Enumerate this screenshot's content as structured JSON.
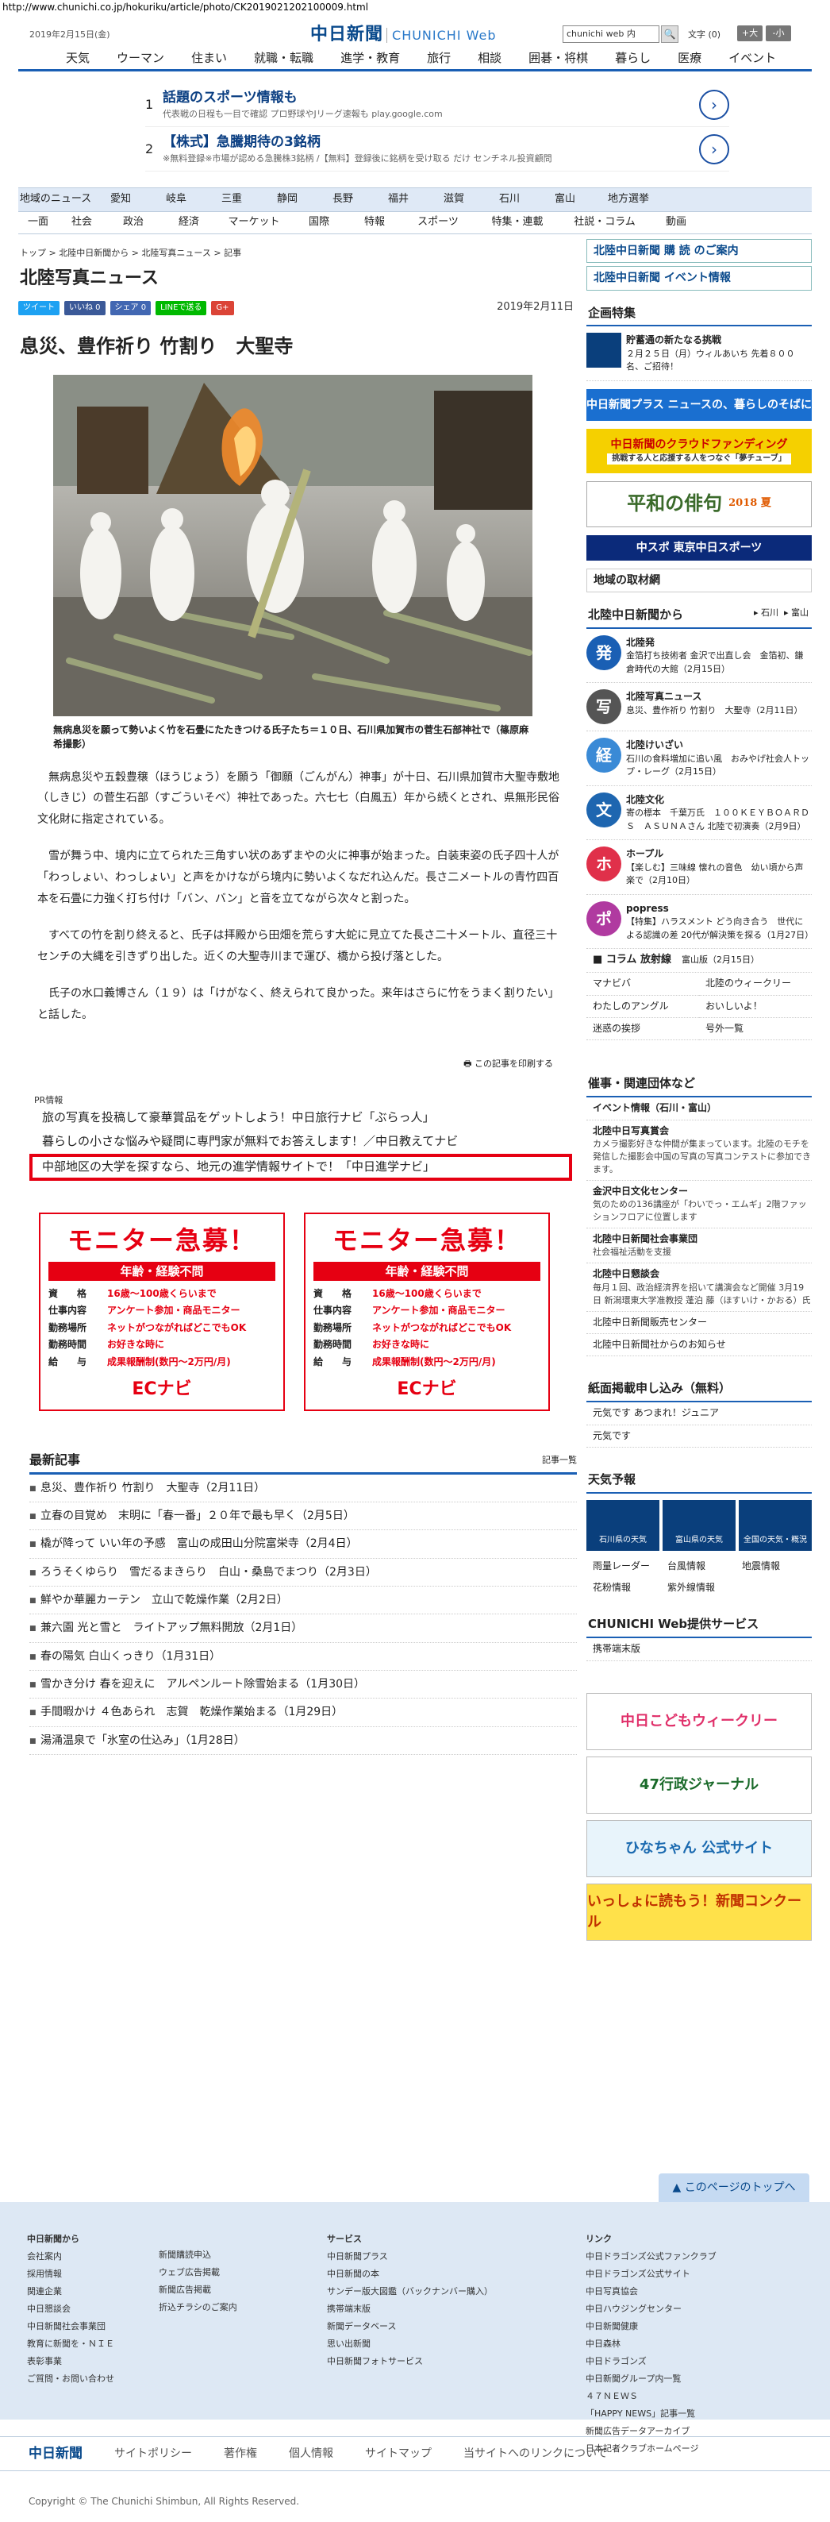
{
  "url": "http://www.chunichi.co.jp/hokuriku/article/photo/CK2019021202100009.html",
  "header": {
    "date": "2019年2月15日(金)",
    "logo": "中日新聞",
    "logo_web": "CHUNICHI Web",
    "search_value": "chunichi web 内",
    "font_size_label": "文字",
    "font_zero": "(0)",
    "font_plus": "+大",
    "font_minus": "-小"
  },
  "global_nav": [
    "天気",
    "ウーマン",
    "住まい",
    "就職・転職",
    "進学・教育",
    "旅行",
    "相談",
    "囲碁・将棋",
    "暮らし",
    "医療",
    "イベント"
  ],
  "ads": [
    {
      "num": "1",
      "title": "話題のスポーツ情報も",
      "sub": "代表戦の日程も一目で確認 プロ野球やJリーグ速報も play.google.com"
    },
    {
      "num": "2",
      "title": "【株式】急騰期待の3銘柄",
      "sub": "※無料登録※市場が認める急騰株3銘柄 /【無料】登録後に銘柄を受け取る だけ センチネル投資顧問"
    }
  ],
  "category_nav": {
    "row1": [
      "地域のニュース",
      "愛知",
      "岐阜",
      "三重",
      "静岡",
      "長野",
      "福井",
      "滋賀",
      "石川",
      "富山",
      "地方選挙"
    ],
    "row2": [
      "一面",
      "社会",
      "政治",
      "経済",
      "マーケット",
      "国際",
      "特報",
      "スポーツ",
      "特集・連載",
      "社説・コラム",
      "動画"
    ]
  },
  "breadcrumb": "トップ > 北陸中日新聞から > 北陸写真ニュース > 記事",
  "section_title": "北陸写真ニュース",
  "social": {
    "tweet": "ツイート",
    "like": "いいね 0",
    "share": "シェア 0",
    "line": "LINEで送る",
    "gplus": "G+"
  },
  "article": {
    "date": "2019年2月11日",
    "headline": "息災、豊作祈り 竹割り　大聖寺",
    "caption": "無病息災を願って勢いよく竹を石畳にたたきつける氏子たち＝１０日、石川県加賀市の菅生石部神社で（篠原麻希撮影）",
    "paragraphs": [
      "無病息災や五穀豊穣（ほうじょう）を願う「御願（ごんがん）神事」が十日、石川県加賀市大聖寺敷地（しきじ）の菅生石部（すごういそべ）神社であった。六七七（白鳳五）年から続くとされ、県無形民俗文化財に指定されている。",
      "雪が舞う中、境内に立てられた三角すい状のあずまやの火に神事が始まった。白装束姿の氏子四十人が「わっしょい、わっしょい」と声をかけながら境内に勢いよくなだれ込んだ。長さ二メートルの青竹四百本を石畳に力強く打ち付け「バン、バン」と音を立てながら次々と割った。",
      "すべての竹を割り終えると、氏子は拝殿から田畑を荒らす大蛇に見立てた長さ二十メートル、直径三十センチの大縄を引きずり出した。近くの大聖寺川まで運び、橋から投げ落とした。",
      "氏子の水口義博さん（１９）は「けがなく、終えられて良かった。来年はさらに竹をうまく割りたい」と話した。"
    ],
    "print_label": "この記事を印刷する"
  },
  "pr": {
    "label": "PR情報",
    "items": [
      "旅の写真を投稿して豪華賞品をゲットしよう！中日旅行ナビ「ぶらっ人」",
      "暮らしの小さな悩みや疑問に専門家が無料でお答えします！／中日教えてナビ",
      "中部地区の大学を探すなら、地元の進学情報サイトで！「中日進学ナビ」"
    ]
  },
  "banner": {
    "title": "モニター急募！",
    "sub": "年齢・経験不問",
    "rows": [
      {
        "k": "資　　格",
        "v": "16歳〜100歳くらいまで"
      },
      {
        "k": "仕事内容",
        "v": "アンケート参加・商品モニター"
      },
      {
        "k": "勤務場所",
        "v": "ネットがつながればどこでもOK"
      },
      {
        "k": "勤務時間",
        "v": "お好きな時に"
      },
      {
        "k": "給　　与",
        "v": "成果報酬制(数円〜2万円/月)"
      }
    ],
    "brand": "ECナビ"
  },
  "latest": {
    "title": "最新記事",
    "all_label": "記事一覧",
    "items": [
      "息災、豊作祈り 竹割り　大聖寺（2月11日）",
      "立春の目覚め　末明に「春一番」２０年で最も早く（2月5日）",
      "橇が降って いい年の予感　富山の成田山分院富栄寺（2月4日）",
      "ろうそくゆらり　雪だるまきらり　白山・桑島でまつり（2月3日）",
      "鮮やか華麗カーテン　立山で乾燥作業（2月2日）",
      "兼六園 光と雪と　ライトアップ無料開放（2月1日）",
      "春の陽気 白山くっきり（1月31日）",
      "雪かき分け 春を迎えに　アルペンルート除雪始まる（1月30日）",
      "手間暇かけ ４色あられ　志賀　乾燥作業始まる（1月29日）",
      "湯涌温泉で「氷室の仕込み」（1月28日）"
    ]
  },
  "side": {
    "subscribe": "北陸中日新聞 購 読 のご案内",
    "event": "北陸中日新聞 イベント情報",
    "feature_title": "企画特集",
    "feature_item": "貯蓄通の新たなる挑戦",
    "feature_sub": "２月２５日（月）ウィルあいち 先着８００名、ご招待！",
    "blue_banner": "中日新聞プラス ニュースの、暮らしのそばに",
    "crowdfunding": "中日新聞のクラウドファンディング",
    "crowd_sub": "挑戦する人と応援する人をつなぐ「夢チューブ」",
    "haiku": "平和の俳句",
    "haiku_year": "2018 夏",
    "sports": "中スポ 東京中日スポーツ",
    "local_label": "地域の取材網",
    "hokuriku_title": "北陸中日新聞から",
    "hokuriku_links": [
      "石川",
      "富山"
    ],
    "items": [
      {
        "icon": "発",
        "color": "#1a5fb4",
        "title": "北陸発",
        "text": "金箔打ち技術者 金沢で出直し会　金箔初、鎌倉時代の大館（2月15日）"
      },
      {
        "icon": "写",
        "color": "#555",
        "title": "北陸写真ニュース",
        "text": "息災、豊作祈り 竹割り　大聖寺（2月11日）"
      },
      {
        "icon": "経",
        "color": "#3a8ad6",
        "title": "北陸けいざい",
        "text": "石川の食料増加に追い風　おみやげ社会人トップ・レーグ（2月15日）"
      },
      {
        "icon": "文",
        "color": "#1e66b0",
        "title": "北陸文化",
        "text": "寄の標本　千葉万氏　１００ＫＥＹＢＯＡＲＤＳ　ＡＳＵＮＡさん 北陸で初演奏（2月9日）"
      },
      {
        "icon": "ホ",
        "color": "#e0304a",
        "title": "ホープル",
        "text": "【楽しむ】三味線 懐れの音色　幼い頃から声楽で（2月10日）"
      },
      {
        "icon": "ポ",
        "color": "#b03aa0",
        "title": "popress",
        "text": "【特集】ハラスメント どう向き合う　世代による認識の差 20代が解決策を探る（1月27日）"
      }
    ],
    "column_title": "コラム 放射線",
    "column_date": "富山版（2月15日）",
    "grid_links": [
      "マナビバ",
      "北陸のウィークリー",
      "わたしのアングル",
      "おいしいよ！",
      "迷惑の挨拶",
      "号外一覧"
    ],
    "event_title": "催事・関連団体など",
    "event_sub": "イベント情報（石川・富山）",
    "events": [
      {
        "t": "北陸中日写真賞会",
        "d": "カメラ撮影好きな仲間が集まっています。北陸のモチを発信した撮影会中国の写真の写真コンテストに参加できます。"
      },
      {
        "t": "金沢中日文化センター",
        "d": "気のための136講座が「わいでっ・エムギ」2階ファッションフロアに位置します"
      },
      {
        "t": "北陸中日新聞社会事業団",
        "d": "社会福祉活動を支援"
      },
      {
        "t": "北陸中日懇談会",
        "d": "毎月１回、政治経済界を招いて講演会など開催 3月19日 新潟環東大学准教授 蓬泊 藤（ほすいけ・かおる）氏"
      }
    ],
    "misc_links": [
      "北陸中日新聞販売センター",
      "北陸中日新聞社からのお知らせ"
    ],
    "paper_title": "紙面掲載申し込み（無料）",
    "paper_links": [
      "元気です あつまれ！ジュニア",
      "元気です"
    ],
    "weather_title": "天気予報",
    "weather": [
      "石川県の天気",
      "富山県の天気",
      "全国の天気・概況"
    ],
    "weather_links": [
      "雨量レーダー",
      "台風情報",
      "地震情報",
      "花粉情報",
      "紫外線情報"
    ],
    "services_title": "CHUNICHI Web提供サービス",
    "services_link": "携帯端末版",
    "ad_kodomo": "中日こどもウィークリー",
    "ad_gyosei": "47行政ジャーナル",
    "ad_4koma": "ひなちゃん 公式サイト",
    "ad_nie": "いっしょに読もう！新聞コンクール"
  },
  "footer": {
    "to_top": "このページのトップへ",
    "cols": [
      {
        "title": "中日新聞から",
        "items": [
          "会社案内",
          "採用情報",
          "関連企業",
          "中日懇談会",
          "中日新聞社会事業団",
          "教育に新聞を・ＮＩＥ",
          "表彰事業",
          "ご質問・お問い合わせ"
        ]
      },
      {
        "title": "",
        "items": [
          "新聞購読申込",
          "ウェブ広告掲載",
          "新聞広告掲載",
          "折込チラシのご案内"
        ]
      },
      {
        "title": "サービス",
        "items": [
          "中日新聞プラス",
          "中日新聞の本",
          "サンデー版大図鑑（バックナンバー購入）",
          "携帯端末版",
          "新聞データベース",
          "思い出新聞",
          "中日新聞フォトサービス"
        ]
      },
      {
        "title": "リンク",
        "items": [
          "中日ドラゴンズ公式ファンクラブ",
          "中日ドラゴンズ公式サイト",
          "中日写真協会",
          "中日ハウジングセンター",
          "中日新聞健康",
          "中日森林",
          "中日ドラゴンズ",
          "中日新聞グループ内一覧",
          "４７ＮＥＷＳ",
          "「HAPPY NEWS」記事一覧",
          "新聞広告データアーカイブ",
          "日本記者クラブホームページ"
        ]
      }
    ],
    "bar": [
      "中日新聞",
      "サイトポリシー",
      "著作権",
      "個人情報",
      "サイトマップ",
      "当サイトへのリンクについて"
    ],
    "copyright": "Copyright © The Chunichi Shimbun, All Rights Reserved."
  }
}
